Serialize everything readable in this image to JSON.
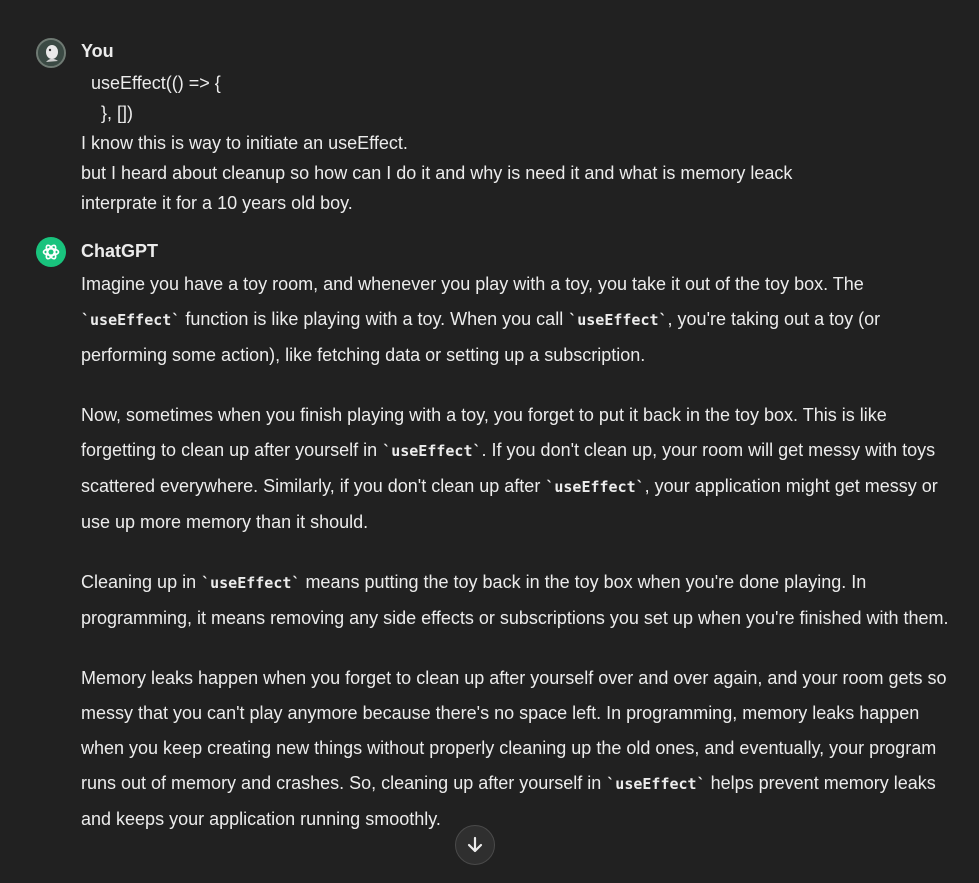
{
  "user": {
    "name": "You",
    "message_lines": [
      "  useEffect(() => {",
      "    }, [])",
      "I know this is way to initiate an useEffect.",
      "but I heard about cleanup so how can I do it and why is need it and what is memory leack",
      "interprate it for a 10 years old boy."
    ]
  },
  "assistant": {
    "name": "ChatGPT",
    "paragraphs": [
      [
        {
          "t": "Imagine you have a toy room, and whenever you play with a toy, you take it out of the toy box. The "
        },
        {
          "code": "`useEffect`"
        },
        {
          "t": " function is like playing with a toy. When you call "
        },
        {
          "code": "`useEffect`"
        },
        {
          "t": ", you're taking out a toy (or performing some action), like fetching data or setting up a subscription."
        }
      ],
      [
        {
          "t": "Now, sometimes when you finish playing with a toy, you forget to put it back in the toy box. This is like forgetting to clean up after yourself in "
        },
        {
          "code": "`useEffect`"
        },
        {
          "t": ". If you don't clean up, your room will get messy with toys scattered everywhere. Similarly, if you don't clean up after "
        },
        {
          "code": "`useEffect`"
        },
        {
          "t": ", your application might get messy or use up more memory than it should."
        }
      ],
      [
        {
          "t": "Cleaning up in "
        },
        {
          "code": "`useEffect`"
        },
        {
          "t": " means putting the toy back in the toy box when you're done playing. In programming, it means removing any side effects or subscriptions you set up when you're finished with them."
        }
      ],
      [
        {
          "t": "Memory leaks happen when you forget to clean up after yourself over and over again, and your room gets so messy that you can't play anymore because there's no space left. In programming, memory leaks happen when you keep creating new things without properly cleaning up the old ones, and eventually, your program runs out of memory and crashes. So, cleaning up after yourself in "
        },
        {
          "code": "`useEffect`"
        },
        {
          "t": " helps prevent memory leaks and keeps your application running smoothly."
        }
      ]
    ]
  },
  "controls": {
    "scroll_down_icon": "arrow-down-icon"
  },
  "colors": {
    "background": "#212121",
    "text": "#ececec",
    "assistant_avatar": "#19c37d"
  }
}
